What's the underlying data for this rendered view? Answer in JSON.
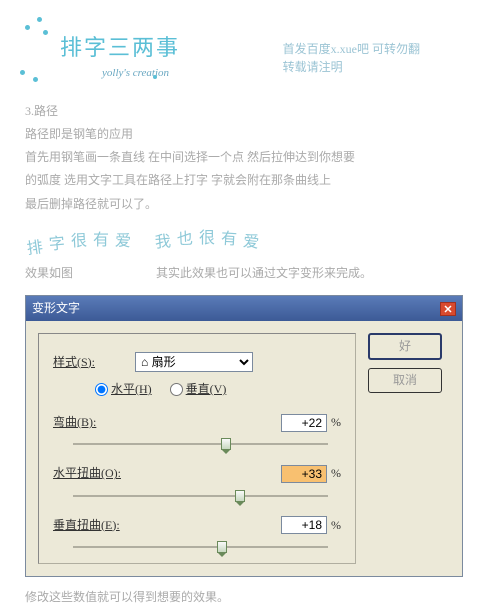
{
  "header": {
    "title": "排字三两事",
    "subtitle": "yolly's creation",
    "line1": "首发百度x.xue吧 可转勿翻",
    "line2": "转载请注明"
  },
  "body": {
    "p1": "3.路径",
    "p2": "路径即是钢笔的应用",
    "p3": "首先用钢笔画一条直线  在中间选择一个点 然后拉伸达到你想要",
    "p4": "的弧度 选用文字工具在路径上打字 字就会附在那条曲线上",
    "p5": "最后删掉路径就可以了。",
    "effect_label": "效果如图",
    "effect_note": "其实此效果也可以通过文字变形来完成。",
    "curved": [
      "排",
      "字",
      "很",
      "有",
      "爱",
      "我",
      "也",
      "很",
      "有",
      "爱"
    ]
  },
  "dialog": {
    "title": "变形文字",
    "style_label": "样式(S):",
    "style_value": "⌂ 扇形",
    "horiz": "水平(H)",
    "vert": "垂直(V)",
    "bend_label": "弯曲(B):",
    "bend_value": "+22",
    "hdist_label": "水平扭曲(O):",
    "hdist_value": "+33",
    "vdist_label": "垂直扭曲(E):",
    "vdist_value": "+18",
    "pct": "%",
    "ok": "好",
    "cancel": "取消"
  },
  "footer": "修改这些数值就可以得到想要的效果。"
}
